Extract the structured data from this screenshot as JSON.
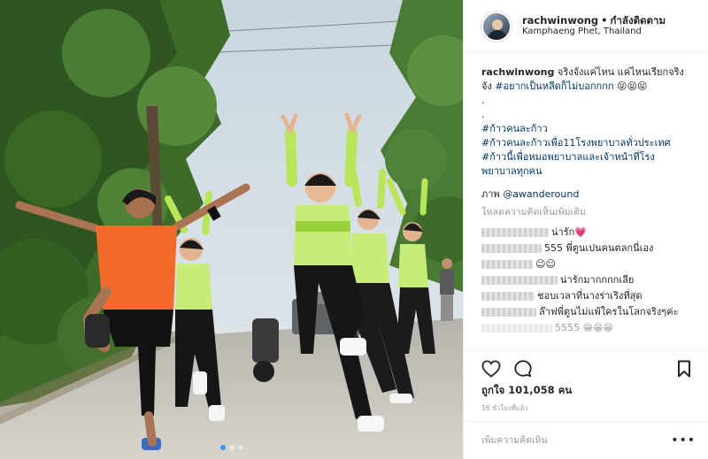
{
  "post": {
    "username": "rachwinwong",
    "separator": "•",
    "follow_label": "กำลังติดตาม",
    "location": "Kamphaeng Phet, Thailand",
    "caption": {
      "username": "rachwinwong",
      "text_1": "จริงจังแค่ไหน แค่ไหนเรียกจริง",
      "text_2": "จัง",
      "hashtag_1": "#อยากเป็นหลีดก็ไม่บอกกกก",
      "emoji": "😝😝😝",
      "dot_1": ".",
      "dot_2": ".",
      "hashtag_2": "#ก้าวคนละก้าว",
      "hashtag_3": "#ก้าวคนละก้าวเพื่อ11โรงพยาบาลทั่วประเทศ",
      "hashtag_4a": "#ก้าวนี้เพื่อหมอพยาบาลและเจ้าหน้าที่โรง",
      "hashtag_4b": "พยาบาลทุกคน"
    },
    "credit_label": "ภาพ",
    "credit_user": "@awanderound",
    "load_more": "โหลดความคิดเห็นเพิ่มเติม",
    "comments": [
      {
        "text": "น่ารัก💗"
      },
      {
        "text": "555 พี่ตูนเปนคนตลกนี่เอง"
      },
      {
        "text": "☺☺"
      },
      {
        "text": "น่ารักมากกกกเลีย"
      },
      {
        "text": "ชอบเวลาที่นางร่าเริงที่สุด"
      },
      {
        "text": "ล๊าฟพี่ตูนไม่แพ้ใครในโลกจริงๆค่ะ"
      },
      {
        "text": "5555 😁😁😁"
      }
    ],
    "likes_label": "ถูกใจ",
    "likes_count": "101,058",
    "likes_unit": "คน",
    "timestamp": "16 ชั่วโมงที่แล้ว",
    "add_comment_placeholder": "เพิ่มความคิดเห็น",
    "more_label": "•••"
  },
  "icons": {
    "like": "heart-icon",
    "comment": "comment-icon",
    "save": "bookmark-icon",
    "more": "more-icon"
  },
  "colors": {
    "hashtag": "#003569",
    "carousel_active": "#3897f0",
    "jersey_orange": "#f26b2a",
    "cheer_green": "#b9e55a"
  }
}
